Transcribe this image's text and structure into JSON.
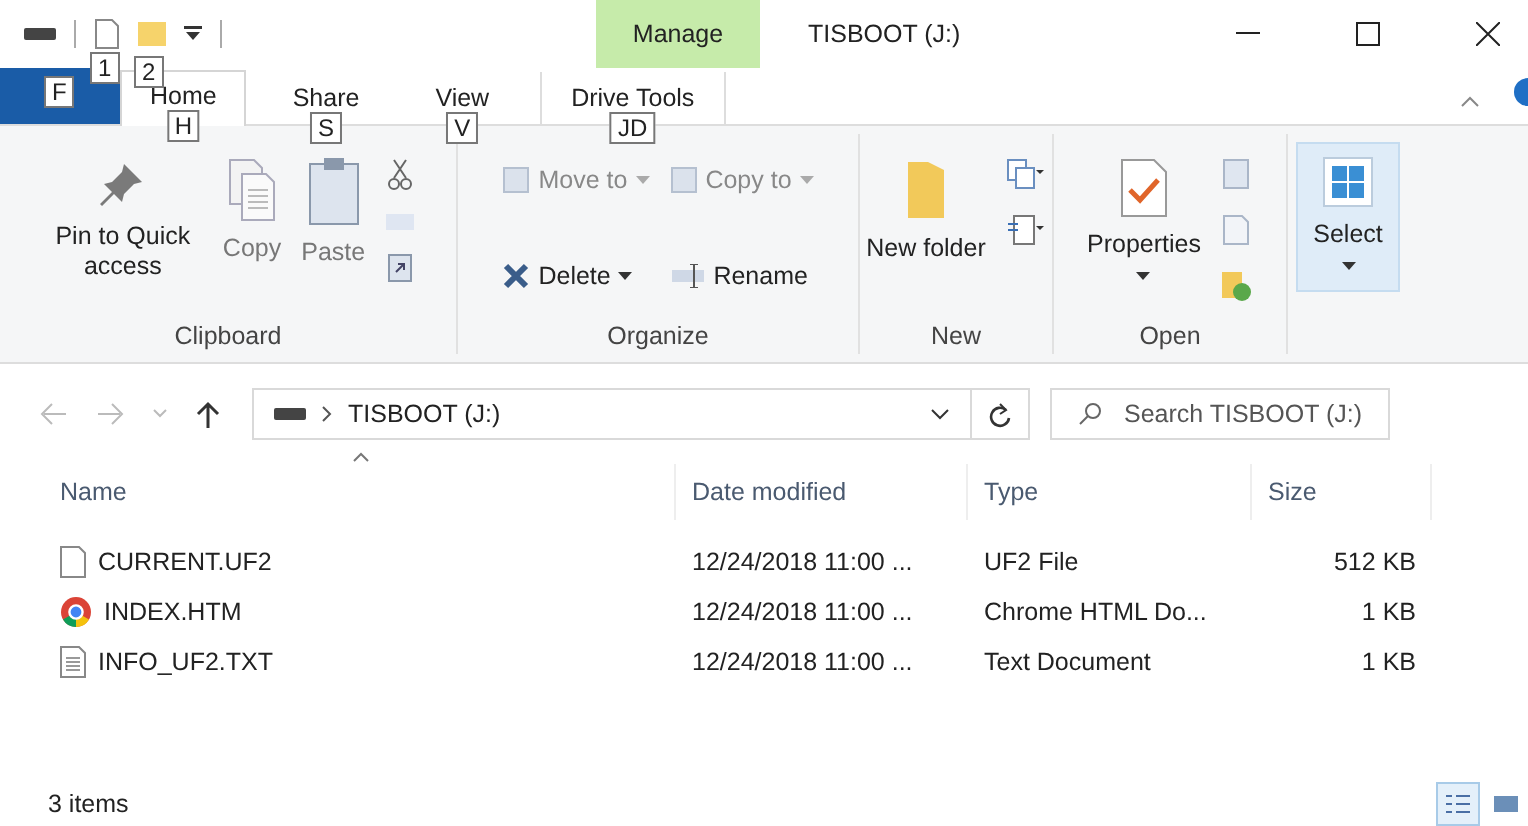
{
  "window": {
    "title": "TISBOOT (J:)",
    "context_tab": "Manage"
  },
  "quick_access": [
    {
      "kind": "file",
      "keytip": "1"
    },
    {
      "kind": "folder",
      "keytip": "2"
    }
  ],
  "tabs": [
    {
      "keytip": "F",
      "kind": "file",
      "selected": false
    },
    {
      "label": "Home",
      "keytip": "H",
      "kind": "tab",
      "selected": true
    },
    {
      "label": "Share",
      "keytip": "S",
      "kind": "tab",
      "selected": false
    },
    {
      "label": "View",
      "keytip": "V",
      "kind": "tab",
      "selected": false
    },
    {
      "label": "Drive Tools",
      "keytip": "JD",
      "kind": "context",
      "selected": false
    }
  ],
  "ribbon": {
    "groups": [
      {
        "label": "Clipboard",
        "kind": "clipboard",
        "buttons": [
          {
            "label": "Pin to Quick access",
            "kind": "pin",
            "disabled": false
          },
          {
            "label": "Copy",
            "kind": "copy",
            "disabled": true
          },
          {
            "label": "Paste",
            "kind": "paste",
            "disabled": true
          }
        ]
      },
      {
        "label": "Organize",
        "kind": "organize",
        "buttons": [
          {
            "label": "Move to",
            "kind": "move",
            "disabled": true
          },
          {
            "label": "Copy to",
            "kind": "copyto",
            "disabled": true
          },
          {
            "label": "Delete",
            "kind": "delete",
            "disabled": false
          },
          {
            "label": "Rename",
            "kind": "rename",
            "disabled": false
          }
        ]
      },
      {
        "label": "New",
        "kind": "new",
        "buttons": [
          {
            "label": "New folder",
            "disabled": false
          }
        ]
      },
      {
        "label": "Open",
        "kind": "open",
        "buttons": [
          {
            "label": "Properties",
            "disabled": false
          }
        ]
      },
      {
        "kind": "select",
        "buttons": [
          {
            "label": "Select",
            "disabled": false
          }
        ]
      }
    ]
  },
  "address": {
    "path": "TISBOOT (J:)",
    "search_placeholder": "Search TISBOOT (J:)"
  },
  "table": {
    "columns": [
      "Name",
      "Date modified",
      "Type",
      "Size"
    ],
    "rows": [
      {
        "kind": "file",
        "name": "CURRENT.UF2",
        "date": "12/24/2018 11:00 ...",
        "type": "UF2 File",
        "size": "512 KB"
      },
      {
        "kind": "chrome",
        "name": "INDEX.HTM",
        "date": "12/24/2018 11:00 ...",
        "type": "Chrome HTML Do...",
        "size": "1 KB"
      },
      {
        "kind": "text",
        "name": "INFO_UF2.TXT",
        "date": "12/24/2018 11:00 ...",
        "type": "Text Document",
        "size": "1 KB"
      }
    ]
  },
  "status_bar": {
    "count": "3 items",
    "views": [
      {
        "kind": "details",
        "selected": true
      },
      {
        "kind": "tiles",
        "selected": false
      }
    ]
  }
}
